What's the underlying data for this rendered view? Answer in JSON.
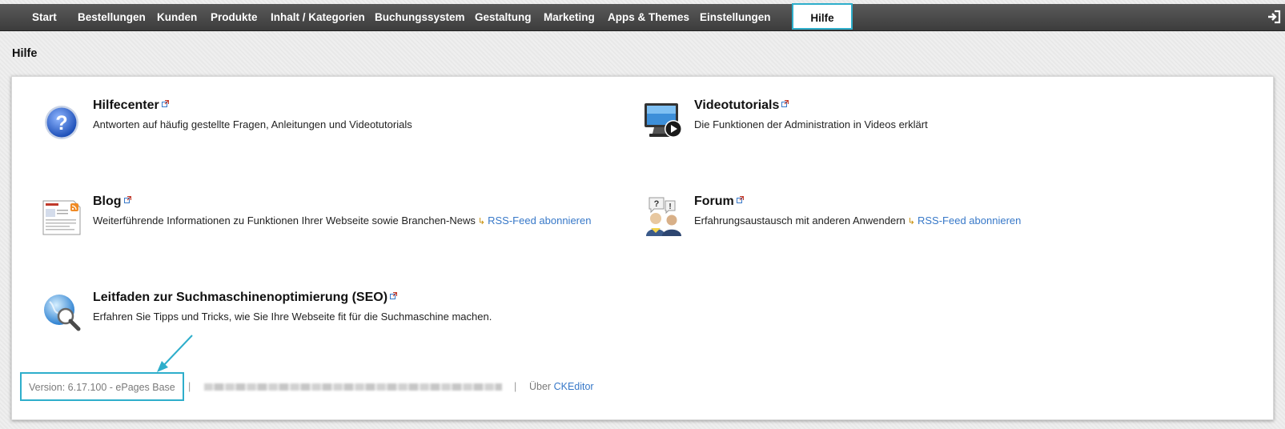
{
  "nav": {
    "items": [
      "Start",
      "Bestellungen",
      "Kunden",
      "Produkte",
      "Inhalt / Kategorien",
      "Buchungssystem",
      "Gestaltung",
      "Marketing",
      "Apps & Themes",
      "Einstellungen"
    ],
    "active": "Hilfe",
    "logout_icon": "logout-icon"
  },
  "page": {
    "title": "Hilfe"
  },
  "entries": {
    "hilfecenter": {
      "title": "Hilfecenter",
      "desc": "Antworten auf häufig gestellte Fragen, Anleitungen und Videotutorials",
      "icon": "help-question-icon"
    },
    "videotutorials": {
      "title": "Videotutorials",
      "desc": "Die Funktionen der Administration in Videos erklärt",
      "icon": "video-monitor-icon"
    },
    "blog": {
      "title": "Blog",
      "desc": "Weiterführende Informationen zu Funktionen Ihrer Webseite sowie Branchen-News",
      "rss_label": "RSS-Feed abonnieren",
      "icon": "blog-document-icon"
    },
    "forum": {
      "title": "Forum",
      "desc": "Erfahrungsaustausch mit anderen Anwendern",
      "rss_label": "RSS-Feed abonnieren",
      "icon": "forum-users-icon"
    },
    "seo": {
      "title": "Leitfaden zur Suchmaschinenoptimierung (SEO)",
      "desc": "Erfahren Sie Tipps und Tricks, wie Sie Ihre Webseite fit für die Suchmaschine machen.",
      "icon": "globe-search-icon"
    }
  },
  "footer": {
    "version": "Version: 6.17.100 - ePages Base",
    "separator": "|",
    "about_prefix": "Über",
    "about_link": "CKEditor"
  },
  "colors": {
    "accent": "#2eaecb",
    "link": "#3778c8",
    "topbar": "#474747"
  }
}
